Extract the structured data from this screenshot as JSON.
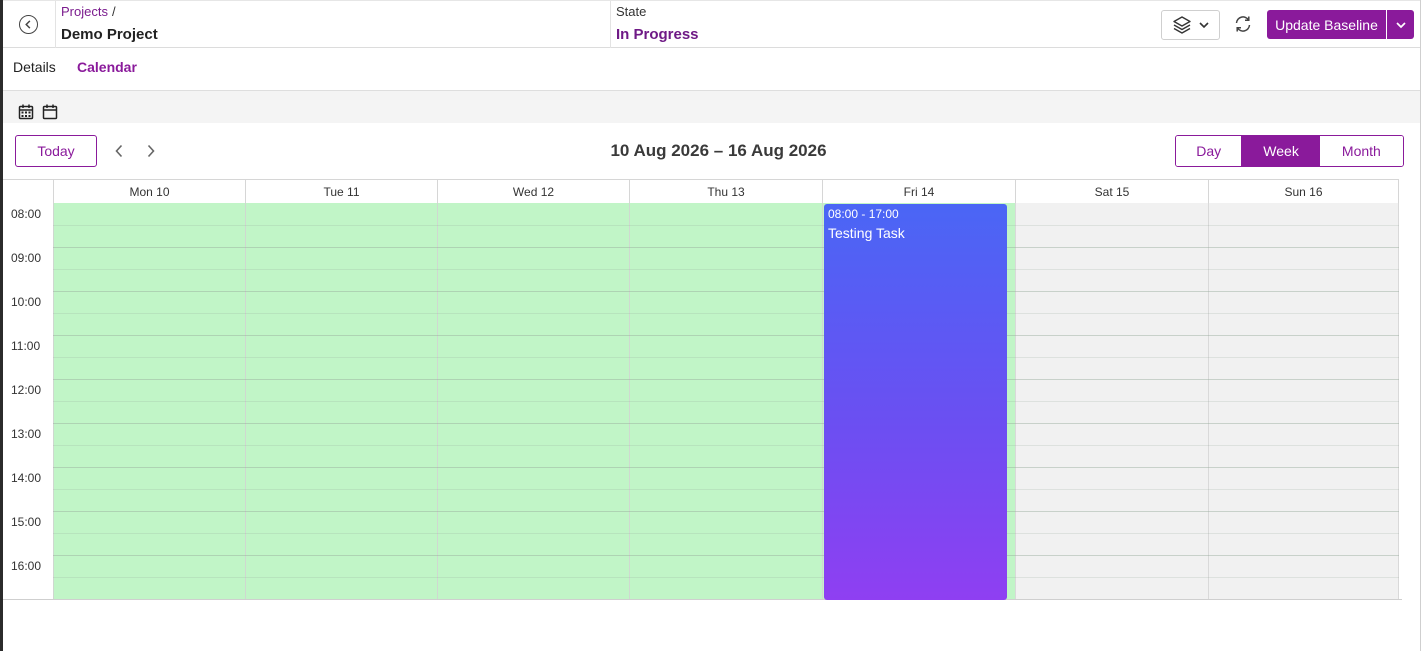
{
  "header": {
    "breadcrumb": "Projects",
    "breadcrumb_sep": "/",
    "project_name": "Demo Project",
    "state_label": "State",
    "state_value": "In Progress",
    "update_baseline_label": "Update Baseline",
    "icons": {
      "back": "back-circle-icon",
      "layers": "layers-icon",
      "refresh": "refresh-icon",
      "caret": "chevron-down-icon"
    }
  },
  "tabs": [
    {
      "label": "Details",
      "active": false
    },
    {
      "label": "Calendar",
      "active": true
    }
  ],
  "toolbar": {
    "icons": [
      "calendar-grid-icon",
      "calendar-icon"
    ]
  },
  "calendar": {
    "today_label": "Today",
    "range_title": "10 Aug 2026 – 16 Aug 2026",
    "views": [
      {
        "label": "Day",
        "active": false
      },
      {
        "label": "Week",
        "active": true
      },
      {
        "label": "Month",
        "active": false
      }
    ],
    "days": [
      {
        "label": "Mon 10",
        "working": true
      },
      {
        "label": "Tue 11",
        "working": true
      },
      {
        "label": "Wed 12",
        "working": true
      },
      {
        "label": "Thu 13",
        "working": true
      },
      {
        "label": "Fri 14",
        "working": true
      },
      {
        "label": "Sat 15",
        "working": false
      },
      {
        "label": "Sun 16",
        "working": false
      }
    ],
    "times": [
      "08:00",
      "09:00",
      "10:00",
      "11:00",
      "12:00",
      "13:00",
      "14:00",
      "15:00",
      "16:00"
    ],
    "events": [
      {
        "time": "08:00 - 17:00",
        "title": "Testing Task",
        "day": "Fri 14"
      }
    ],
    "colors": {
      "working_day": "#c1f5c7",
      "off_day": "#f1f1f1",
      "event_start": "#4a66f5",
      "event_end": "#8f3ff2",
      "accent": "#8a1a9b"
    }
  }
}
